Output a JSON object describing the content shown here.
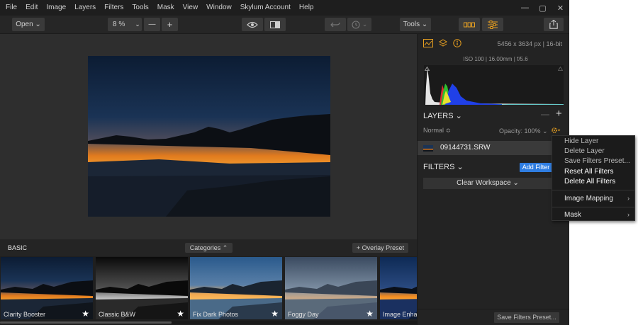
{
  "menubar": {
    "items": [
      "File",
      "Edit",
      "Image",
      "Layers",
      "Filters",
      "Tools",
      "Mask",
      "View",
      "Window",
      "Skylum Account",
      "Help"
    ],
    "window_controls": [
      "minimize-icon",
      "restore-icon",
      "close-icon"
    ]
  },
  "toolbar": {
    "open_label": "Open ⌄",
    "zoom_value": "8 %",
    "zoom_out": "—",
    "zoom_in": "+",
    "tools_label": "Tools ⌄"
  },
  "image_info": {
    "dimensions": "5456 x 3634 px  |  16-bit",
    "exif": "ISO 100  |  16.00mm  |  f/5.6"
  },
  "layers": {
    "title": "LAYERS ⌄",
    "remove": "—",
    "add": "+",
    "blend_mode": "Normal ≎",
    "opacity": "Opacity: 100% ⌄",
    "layer_name": "09144731.SRW"
  },
  "filters": {
    "title": "FILTERS ⌄",
    "add_filter": "Add Filter",
    "clear_workspace": "Clear Workspace ⌄",
    "save_preset": "Save Filters Preset..."
  },
  "context_menu": {
    "items": [
      {
        "label": "Hide Layer",
        "style": "muted"
      },
      {
        "label": "Delete Layer",
        "style": "muted"
      },
      {
        "label": "Save Filters Preset...",
        "style": "muted"
      },
      {
        "label": "Reset All Filters",
        "style": "bold"
      },
      {
        "label": "Delete All Filters",
        "style": "bold"
      }
    ],
    "submenus": [
      {
        "label": "Image Mapping",
        "arrow": "›"
      },
      {
        "label": "Mask",
        "arrow": "›"
      }
    ]
  },
  "presets": {
    "category": "BASIC",
    "categories_button": "Categories ⌃",
    "overlay_button": "+ Overlay Preset",
    "items": [
      {
        "label": "Clarity Booster",
        "star": "★"
      },
      {
        "label": "Classic B&W",
        "star": "★"
      },
      {
        "label": "Fix Dark Photos",
        "star": "★"
      },
      {
        "label": "Foggy Day",
        "star": "★"
      },
      {
        "label": "Image Enhancer",
        "star": ""
      }
    ]
  },
  "colors": {
    "accent": "#e8a020",
    "button_blue": "#2f7de1",
    "panel_bg": "#232323"
  }
}
